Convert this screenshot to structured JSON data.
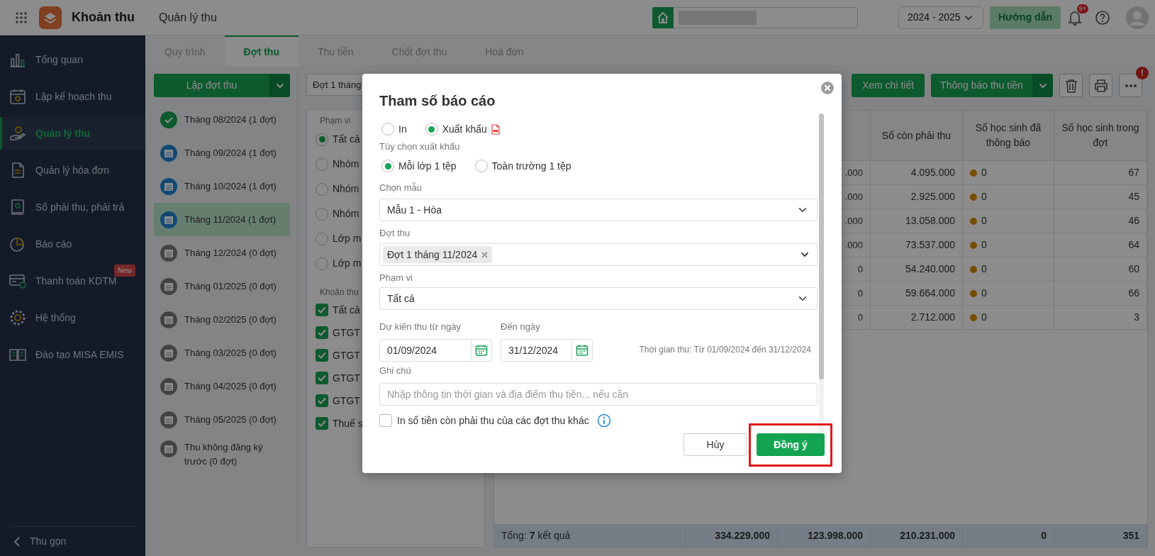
{
  "app": {
    "title": "Khoản thu",
    "page_title": "Quản lý thu"
  },
  "header": {
    "year": "2024 - 2025",
    "guide_button": "Hướng dẫn",
    "notification_count": "9+"
  },
  "sidebar": {
    "items": [
      {
        "label": "Tổng quan",
        "selected": false
      },
      {
        "label": "Lập kế hoạch thu",
        "selected": false
      },
      {
        "label": "Quản lý thu",
        "selected": true
      },
      {
        "label": "Quản lý hóa đơn",
        "selected": false
      },
      {
        "label": "Sổ phải thu, phải trả",
        "selected": false
      },
      {
        "label": "Báo cáo",
        "selected": false
      },
      {
        "label": "Thanh toán KDTM",
        "selected": false,
        "badge": "New"
      },
      {
        "label": "Hệ thống",
        "selected": false
      },
      {
        "label": "Đào tạo MISA EMIS",
        "selected": false
      }
    ],
    "collapse_label": "Thu gọn"
  },
  "tabs": [
    {
      "label": "Quy trình",
      "selected": false
    },
    {
      "label": "Đợt thu",
      "selected": true
    },
    {
      "label": "Thu tiền",
      "selected": false
    },
    {
      "label": "Chốt đợt thu",
      "selected": false
    },
    {
      "label": "Hoá đơn",
      "selected": false
    }
  ],
  "batches": {
    "create_button": "Lập đợt thu",
    "items": [
      {
        "label": "Tháng 08/2024 (1 đợt)",
        "kind": "done",
        "selected": false
      },
      {
        "label": "Tháng 09/2024 (1 đợt)",
        "kind": "active",
        "selected": false
      },
      {
        "label": "Tháng 10/2024 (1 đợt)",
        "kind": "active",
        "selected": false
      },
      {
        "label": "Tháng 11/2024 (1 đợt)",
        "kind": "active",
        "selected": true
      },
      {
        "label": "Tháng 12/2024 (0 đợt)",
        "kind": "pending",
        "selected": false
      },
      {
        "label": "Tháng 01/2025 (0 đợt)",
        "kind": "pending",
        "selected": false
      },
      {
        "label": "Tháng 02/2025 (0 đợt)",
        "kind": "pending",
        "selected": false
      },
      {
        "label": "Tháng 03/2025 (0 đợt)",
        "kind": "pending",
        "selected": false
      },
      {
        "label": "Tháng 04/2025 (0 đợt)",
        "kind": "pending",
        "selected": false
      },
      {
        "label": "Tháng 05/2025 (0 đợt)",
        "kind": "pending",
        "selected": false
      },
      {
        "label": "Thu không đăng ký trước (0 đợt)",
        "kind": "pending",
        "selected": false
      }
    ]
  },
  "filter_panel": {
    "batch_select": "Đợt 1 tháng",
    "scope_label": "Phạm vi",
    "scope_options": [
      {
        "label": "Tất cả",
        "selected": true
      },
      {
        "label": "Nhóm",
        "selected": false
      },
      {
        "label": "Nhóm",
        "selected": false
      },
      {
        "label": "Nhóm",
        "selected": false
      },
      {
        "label": "Lớp m",
        "selected": false
      },
      {
        "label": "Lớp m",
        "selected": false
      }
    ],
    "fee_label": "Khoản thu",
    "fee_options": [
      {
        "label": "Tất cả",
        "checked": true
      },
      {
        "label": "GTGT",
        "checked": true
      },
      {
        "label": "GTGT",
        "checked": true
      },
      {
        "label": "GTGT",
        "checked": true
      },
      {
        "label": "GTGT",
        "checked": true
      },
      {
        "label": "Thuế s",
        "checked": true
      }
    ]
  },
  "toolbar": {
    "detail_button": "Xem chi tiết",
    "notify_button": "Thông báo thu tiền",
    "alert_badge": "!"
  },
  "table": {
    "columns": [
      "Số còn phải thu",
      "Số học sinh đã thông báo",
      "Số học sinh trong đợt"
    ],
    "rows": [
      {
        "column_3": ".000",
        "values": [
          "4.095.000",
          "0",
          "67"
        ]
      },
      {
        "column_3": ".000",
        "values": [
          "2.925.000",
          "0",
          "45"
        ]
      },
      {
        "column_3": ".000",
        "values": [
          "13.058.000",
          "0",
          "46"
        ]
      },
      {
        "column_3": ".000",
        "values": [
          "73.537.000",
          "0",
          "64"
        ]
      },
      {
        "column_3": "0",
        "values": [
          "54.240.000",
          "0",
          "60"
        ]
      },
      {
        "column_3": "0",
        "values": [
          "59.664.000",
          "0",
          "66"
        ]
      },
      {
        "column_3": "0",
        "values": [
          "2.712.000",
          "0",
          "3"
        ]
      }
    ],
    "footer": {
      "summary": "Tổng: **7** kết quả",
      "totals": [
        "334.229.000",
        "123.998.000",
        "210.231.000",
        "0",
        "351"
      ]
    }
  },
  "dialog": {
    "title": "Tham số báo cáo",
    "output_options": [
      {
        "label": "In",
        "selected": false
      },
      {
        "label": "Xuất khẩu",
        "selected": true
      }
    ],
    "export_label": "Tùy chọn xuất khẩu",
    "export_options": [
      {
        "label": "Mỗi lớp 1 tệp",
        "selected": true
      },
      {
        "label": "Toàn trường 1 tệp",
        "selected": false
      }
    ],
    "template": {
      "label": "Chọn mẫu",
      "value": "Mẫu 1 - Hòa"
    },
    "batch": {
      "label": "Đợt thu",
      "tags": [
        "Đợt 1 tháng 11/2024"
      ]
    },
    "scope": {
      "label": "Phạm vi",
      "value": "Tất cả"
    },
    "from_date": {
      "label": "Dự kiến thu từ ngày",
      "value": "01/09/2024"
    },
    "to_date": {
      "label": "Đến ngày",
      "value": "31/12/2024"
    },
    "period_note": "Thời gian thu: Từ 01/09/2024 đến 31/12/2024",
    "note": {
      "label": "Ghi chú",
      "placeholder": "Nhập thông tin thời gian và địa điểm thu tiền... nếu cần"
    },
    "include_other": {
      "label": "In số tiền còn phải thu của các đợt thu khác",
      "checked": false
    },
    "cancel_button": "Hủy",
    "ok_button": "Đồng ý",
    "ok_highlighted": true
  }
}
